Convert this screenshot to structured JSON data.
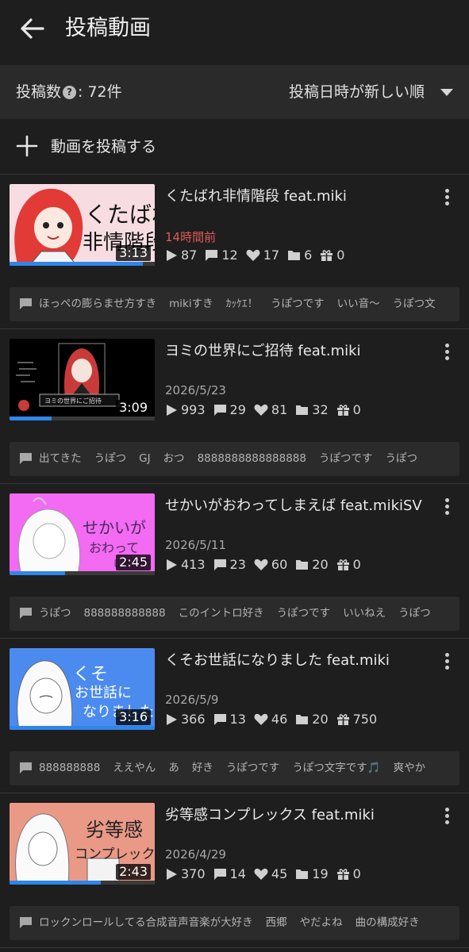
{
  "header": {
    "title": "投稿動画"
  },
  "summary": {
    "count_label": "投稿数",
    "count_value": ": 72件",
    "sort_label": "投稿日時が新しい順"
  },
  "upload": {
    "label": "動画を投稿する"
  },
  "videos": [
    {
      "title": "くたばれ非情階段 feat.miki",
      "date": "14時間前",
      "duration": "3:13",
      "progress": 0.92,
      "views": "87",
      "comments": "12",
      "likes": "17",
      "mylists": "6",
      "gifts": "0",
      "comment_preview": [
        "ほっぺの膨らませ方すき",
        "mikiすき",
        "ｶｯｹｴ！",
        "うぽつです",
        "いい音～",
        "うぽつ文"
      ]
    },
    {
      "title": "ヨミの世界にご招待 feat.miki",
      "date": "2026/5/23",
      "duration": "3:09",
      "progress": 0.29,
      "views": "993",
      "comments": "29",
      "likes": "81",
      "mylists": "32",
      "gifts": "0",
      "comment_preview": [
        "出てきた",
        "うぽつ",
        "GJ",
        "おつ",
        "8888888888888888",
        "うぽつです",
        "うぽつ"
      ]
    },
    {
      "title": "せかいがおわってしまえば feat.mikiSV",
      "date": "2026/5/11",
      "duration": "2:45",
      "progress": 0.38,
      "views": "413",
      "comments": "23",
      "likes": "60",
      "mylists": "20",
      "gifts": "0",
      "comment_preview": [
        "うぽつ",
        "888888888888",
        "このイントロ好き",
        "うぽつです",
        "いいねえ",
        "うぽつ"
      ]
    },
    {
      "title": "くそお世話になりました feat.miki",
      "date": "2026/5/9",
      "duration": "3:16",
      "progress": 1.0,
      "views": "366",
      "comments": "13",
      "likes": "46",
      "mylists": "20",
      "gifts": "750",
      "comment_preview": [
        "888888888",
        "ええやん",
        "あ",
        "好き",
        "うぽつです",
        "うぽつ文字です🎵",
        "爽やか"
      ]
    },
    {
      "title": "劣等感コンプレックス feat.miki",
      "date": "2026/4/29",
      "duration": "2:43",
      "progress": 0.63,
      "views": "370",
      "comments": "14",
      "likes": "45",
      "mylists": "19",
      "gifts": "0",
      "comment_preview": [
        "ロックンロールしてる合成音声音楽が大好き",
        "西郷",
        "やだよね",
        "曲の構成好き"
      ]
    }
  ]
}
